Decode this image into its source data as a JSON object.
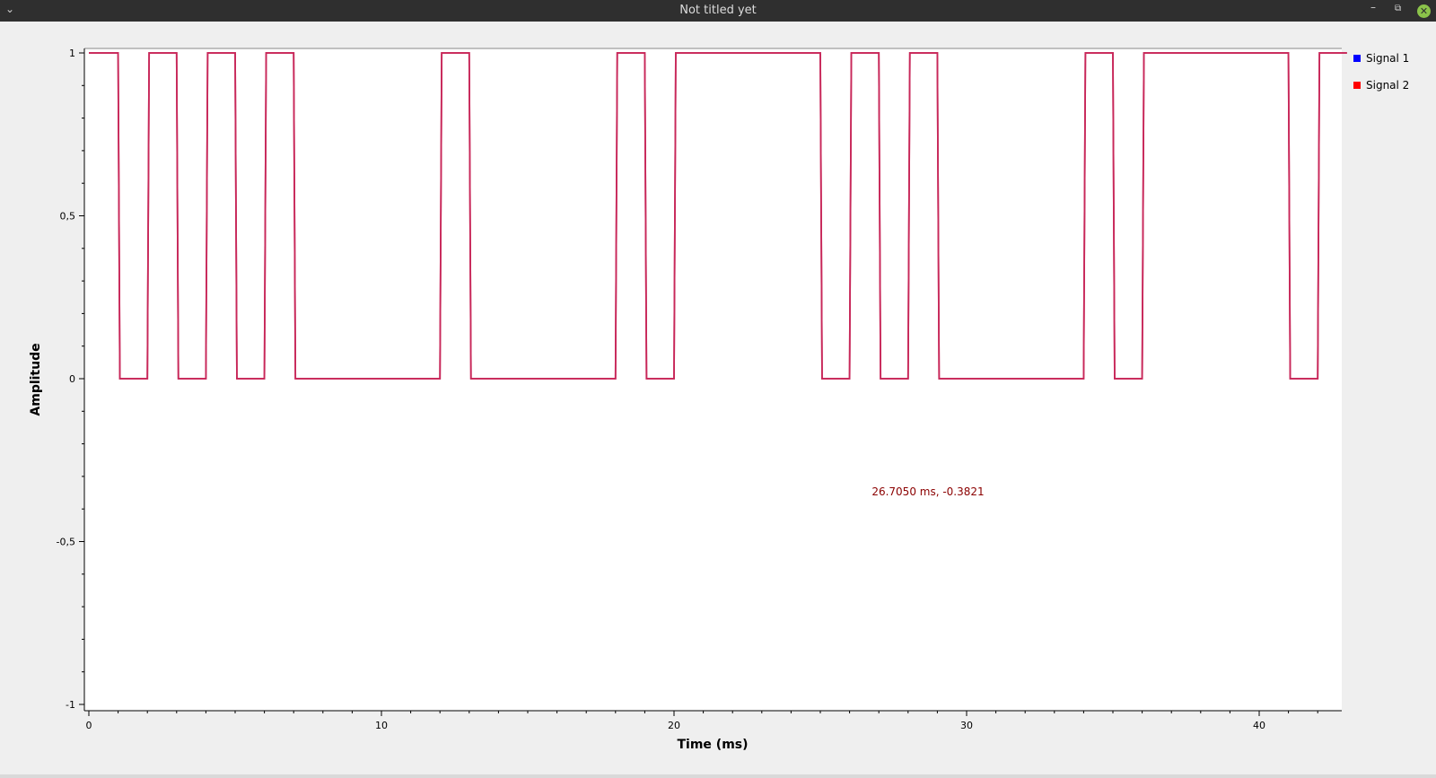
{
  "window": {
    "title": "Not titled yet",
    "menu_icon": "chevron-down-icon",
    "minimize_icon": "minimize-icon",
    "restore_icon": "restore-icon",
    "close_icon": "close-icon"
  },
  "cursor_readout": {
    "text": "26.7050 ms, -0.3821",
    "color": "#8b0000"
  },
  "legend": [
    {
      "label": "Signal 1",
      "color": "#0000ff"
    },
    {
      "label": "Signal 2",
      "color": "#ff0000"
    }
  ],
  "chart_data": {
    "type": "line",
    "xlabel": "Time (ms)",
    "ylabel": "Amplitude",
    "xlim": [
      0,
      43
    ],
    "ylim": [
      -1,
      1
    ],
    "x_ticks": [
      "0",
      "10",
      "20",
      "30",
      "40"
    ],
    "y_ticks": [
      "1",
      "0,5",
      "0",
      "-0,5",
      "-1"
    ],
    "y_tick_values": [
      1,
      0.5,
      0,
      -0.5,
      -1
    ],
    "x_tick_values": [
      0,
      10,
      20,
      30,
      40
    ],
    "grid": false,
    "legend_position": "right",
    "trace_color": "#c8285a",
    "bit_period_ms": 1,
    "series": [
      {
        "name": "Signal 1",
        "color": "#0000ff",
        "bits": [
          1,
          0,
          1,
          0,
          1,
          0,
          1,
          0,
          0,
          0,
          0,
          0,
          1,
          0,
          0,
          0,
          0,
          0,
          1,
          0,
          1,
          1,
          1,
          1,
          1,
          0,
          1,
          0,
          1,
          0,
          0,
          0,
          0,
          0,
          1,
          0,
          1,
          1,
          1,
          1,
          1,
          0,
          1
        ]
      },
      {
        "name": "Signal 2",
        "color": "#ff0000",
        "bits": [
          1,
          0,
          1,
          0,
          1,
          0,
          1,
          0,
          0,
          0,
          0,
          0,
          1,
          0,
          0,
          0,
          0,
          0,
          1,
          0,
          1,
          1,
          1,
          1,
          1,
          0,
          1,
          0,
          1,
          0,
          0,
          0,
          0,
          0,
          1,
          0,
          1,
          1,
          1,
          1,
          1,
          0,
          1
        ]
      }
    ]
  }
}
